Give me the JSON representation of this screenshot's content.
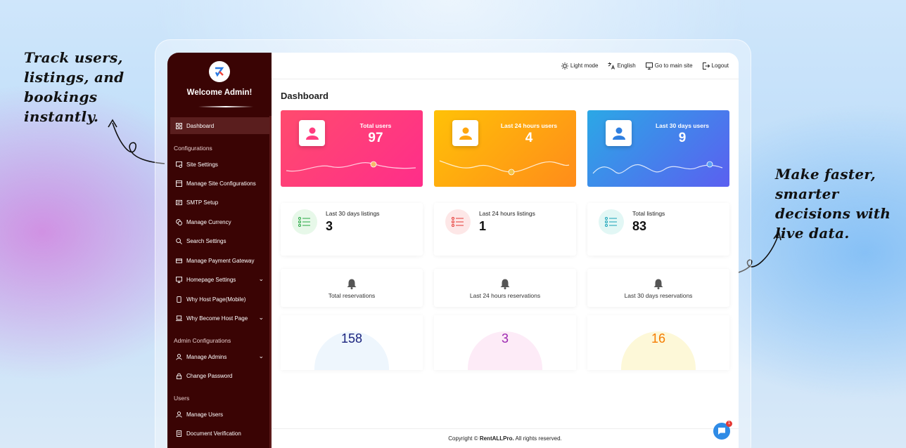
{
  "annotations": {
    "left_note": "Track users, listings, and bookings instantly.",
    "right_note": "Make faster, smarter decisions with live data."
  },
  "sidebar": {
    "welcome": "Welcome Admin!",
    "items": [
      {
        "label": "Dashboard",
        "icon": "grid-icon",
        "active": true
      },
      {
        "label": "Site Settings",
        "icon": "settings-icon"
      },
      {
        "label": "Manage Site Configurations",
        "icon": "config-icon"
      },
      {
        "label": "SMTP Setup",
        "icon": "mail-icon"
      },
      {
        "label": "Manage Currency",
        "icon": "currency-icon"
      },
      {
        "label": "Search Settings",
        "icon": "search-icon"
      },
      {
        "label": "Manage Payment Gateway",
        "icon": "payment-icon"
      },
      {
        "label": "Homepage Settings",
        "icon": "monitor-icon",
        "expandable": true
      },
      {
        "label": "Why Host Page(Mobile)",
        "icon": "mobile-icon"
      },
      {
        "label": "Why Become Host Page",
        "icon": "laptop-icon",
        "expandable": true
      },
      {
        "label": "Manage Admins",
        "icon": "user-icon",
        "expandable": true
      },
      {
        "label": "Change Password",
        "icon": "lock-icon"
      },
      {
        "label": "Manage Users",
        "icon": "user-icon"
      },
      {
        "label": "Document Verification",
        "icon": "document-icon"
      }
    ],
    "sections": [
      "Configurations",
      "Admin Configurations",
      "Users"
    ]
  },
  "topbar": {
    "light_mode": "Light mode",
    "language": "English",
    "main_site": "Go to main site",
    "logout": "Logout"
  },
  "page_title": "Dashboard",
  "stat_cards": [
    {
      "label": "Total users",
      "value": "97",
      "color_from": "#ff4b6e",
      "color_to": "#ff2d8a"
    },
    {
      "label": "Last 24 hours users",
      "value": "4",
      "color_from": "#ffc107",
      "color_to": "#ff8c1a"
    },
    {
      "label": "Last 30 days users",
      "value": "9",
      "color_from": "#2ba8e6",
      "color_to": "#5b5ff0"
    }
  ],
  "listing_cards": [
    {
      "label": "Last 30 days listings",
      "value": "3",
      "circle_color": "#e7f8e9",
      "icon_color": "#27a844"
    },
    {
      "label": "Last 24 hours listings",
      "value": "1",
      "circle_color": "#fde7e7",
      "icon_color": "#e53935"
    },
    {
      "label": "Total listings",
      "value": "83",
      "circle_color": "#e2f7f5",
      "icon_color": "#17a2b8"
    }
  ],
  "reservation_cards": [
    {
      "label": "Total reservations"
    },
    {
      "label": "Last 24 hours reservations"
    },
    {
      "label": "Last 30 days reservations"
    }
  ],
  "gauge_cards": [
    {
      "value": "158",
      "text_color": "#1a237e",
      "fill": "#eef6fd"
    },
    {
      "value": "3",
      "text_color": "#9c27b0",
      "fill": "#fdebf7"
    },
    {
      "value": "16",
      "text_color": "#f57c00",
      "fill": "#fdf8d8"
    }
  ],
  "footer": {
    "prefix": "Copyright © ",
    "brand": "RentALLPro.",
    "suffix": " All rights reserved."
  },
  "chat": {
    "badge": "1"
  }
}
